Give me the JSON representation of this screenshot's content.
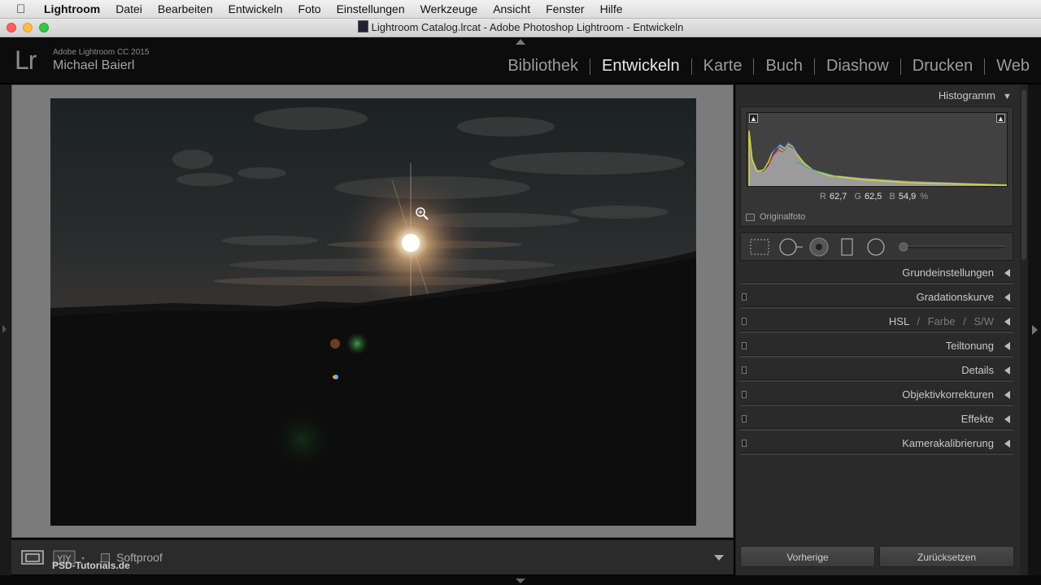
{
  "menubar": {
    "app_name": "Lightroom",
    "items": [
      "Datei",
      "Bearbeiten",
      "Entwickeln",
      "Foto",
      "Einstellungen",
      "Werkzeuge",
      "Ansicht",
      "Fenster",
      "Hilfe"
    ]
  },
  "window": {
    "title": "Lightroom Catalog.lrcat - Adobe Photoshop Lightroom - Entwickeln"
  },
  "header": {
    "logo": "Lr",
    "version": "Adobe Lightroom CC 2015",
    "user": "Michael Baierl",
    "modules": [
      {
        "label": "Bibliothek",
        "active": false
      },
      {
        "label": "Entwickeln",
        "active": true
      },
      {
        "label": "Karte",
        "active": false
      },
      {
        "label": "Buch",
        "active": false
      },
      {
        "label": "Diashow",
        "active": false
      },
      {
        "label": "Drucken",
        "active": false
      },
      {
        "label": "Web",
        "active": false
      }
    ]
  },
  "histogram": {
    "title": "Histogramm",
    "r_label": "R",
    "r_value": "62,7",
    "g_label": "G",
    "g_value": "62,5",
    "b_label": "B",
    "b_value": "54,9",
    "percent": "%",
    "original_label": "Originalfoto"
  },
  "panels": {
    "grundeinstellungen": "Grundeinstellungen",
    "gradationskurve": "Gradationskurve",
    "hsl": "HSL",
    "slash": "/",
    "farbe": "Farbe",
    "sw": "S/W",
    "teiltonung": "Teiltonung",
    "details": "Details",
    "objektiv": "Objektivkorrekturen",
    "effekte": "Effekte",
    "kamera": "Kamerakalibrierung"
  },
  "buttons": {
    "previous": "Vorherige",
    "reset": "Zurücksetzen"
  },
  "toolbar": {
    "softproof": "Softproof",
    "watermark": "PSD-Tutorials.de"
  },
  "colors": {
    "accent_active": "#e8e8e8",
    "panel_bg": "#2a2a2a",
    "canvas_bg": "#7b7b7b"
  }
}
